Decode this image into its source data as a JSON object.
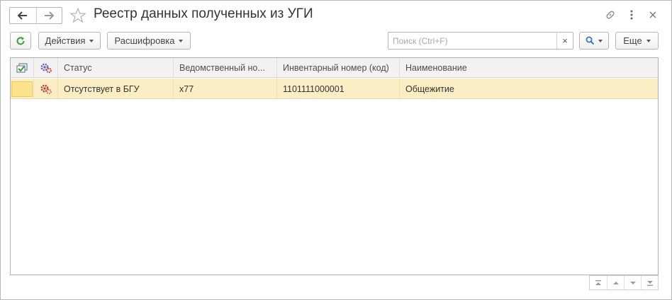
{
  "window": {
    "title": "Реестр данных полученных из УГИ"
  },
  "toolbar": {
    "actions_label": "Действия",
    "decode_label": "Расшифровка",
    "more_label": "Еще",
    "search_placeholder": "Поиск (Ctrl+F)",
    "clear_glyph": "×"
  },
  "table": {
    "columns": {
      "status": "Статус",
      "dept_number": "Ведомственный но...",
      "inventory_number": "Инвентарный номер (код)",
      "name": "Наименование"
    },
    "rows": [
      {
        "status": "Отсутствует в БГУ",
        "dept_number": "x77",
        "inventory_number": "1101111000001",
        "name": "Общежитие"
      }
    ]
  },
  "colors": {
    "selected_row": "#fbeec4",
    "refresh_green": "#3aa335",
    "search_blue": "#3a72c4",
    "gear_red": "#b03a2e",
    "gear_purple": "#6a58b8"
  },
  "icons": [
    "back-arrow-icon",
    "forward-arrow-icon",
    "star-icon",
    "link-icon",
    "more-vertical-icon",
    "close-icon",
    "refresh-icon",
    "search-icon",
    "checklist-icon",
    "gears-icon"
  ]
}
